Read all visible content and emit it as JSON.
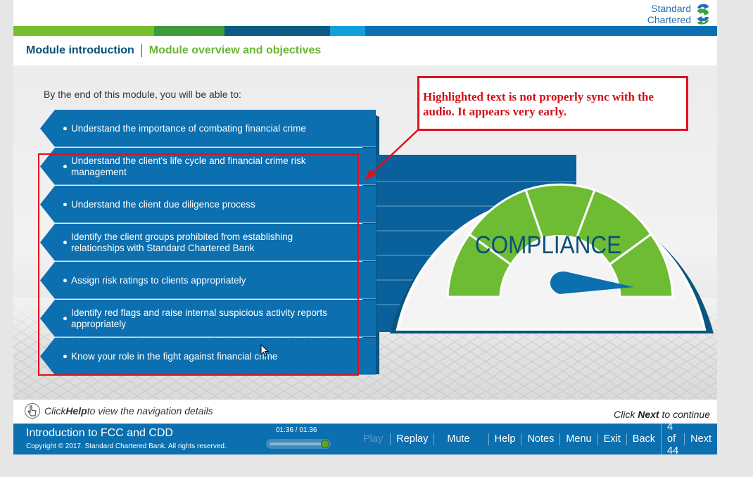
{
  "header": {
    "logo_line1": "Standard",
    "logo_line2": "Chartered",
    "stripe_colors": [
      "#77be2e",
      "#3f9a3a",
      "#0d5b85",
      "#12a0dc",
      "#0b6fb0"
    ],
    "breadcrumb_module": "Module introduction",
    "breadcrumb_section": "Module overview and objectives"
  },
  "content": {
    "intro": "By the end of this module, you will be able to:",
    "objectives": [
      "Understand the importance of combating financial crime",
      "Understand the client's life cycle and financial crime risk management",
      "Understand the client due diligence process",
      "Identify the client groups prohibited from establishing relationships with Standard Chartered Bank",
      "Assign risk ratings to clients appropriately",
      "Identify red flags and raise internal suspicious activity reports appropriately",
      "Know your role in the fight against financial crime"
    ],
    "gauge_label": "COMPLIANCE"
  },
  "annotation": {
    "text": "Highlighted text is not properly sync with the audio. It appears very early."
  },
  "footer": {
    "help_prefix": "Click ",
    "help_word": "Help",
    "help_suffix": " to view the navigation details",
    "continue_prefix": "Click ",
    "continue_word": "Next",
    "continue_suffix": " to continue",
    "course_title": "Introduction to FCC and CDD",
    "copyright": "Copyright © 2017. Standard Chartered Bank. All rights reserved.",
    "timecode": "01:36 / 01:36",
    "progress_fraction": 1.0,
    "nav": {
      "play": "Play",
      "replay": "Replay",
      "mute": "Mute",
      "help": "Help",
      "notes": "Notes",
      "menu": "Menu",
      "exit": "Exit",
      "back": "Back",
      "page": "4 of 44",
      "next": "Next"
    }
  },
  "colors": {
    "primary_blue": "#0b6fb0",
    "dark_blue": "#0b4f79",
    "green": "#6bb536",
    "annotation_red": "#e0101b"
  }
}
